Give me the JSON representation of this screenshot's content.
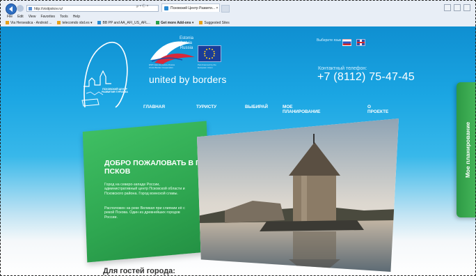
{
  "browser": {
    "url": "http://visitpskov.ru/",
    "url_tools": "℘ • Ⓒ ×",
    "tab_title": "Псковский Центр Развити... ×",
    "menu": [
      "File",
      "Edit",
      "View",
      "Favorites",
      "Tools",
      "Help"
    ],
    "favorites": [
      "Via Herseatica - Android ...",
      "telecomdo xbd.es ▾",
      "BB PP and AA_AFI_US_AFL...",
      "Get more Add-ons ▾",
      "Suggested Sites"
    ]
  },
  "header": {
    "countries": [
      "Estonia",
      "Latvia",
      "Russia"
    ],
    "slogan": "united by borders",
    "program_note": "ENPI Estonia-Latvia-Russia Cross Border Cooperation",
    "eu_note": "Part-financed by the European Union",
    "lang_label": "Выберите язык",
    "phone_label": "Контактный телефон:",
    "phone": "+7 (8112) 75-47-45",
    "logo_caption": "ПСКОВСКИЙ ЦЕНТР РАЗВИТИЯ ТУРИЗМА"
  },
  "menu": [
    "ГЛАВНАЯ",
    "ТУРИСТУ",
    "ВЫБИРАЙ",
    "МОЕ ПЛАНИРОВАНИЕ",
    "О ПРОЕКТЕ"
  ],
  "side_tab": "Мое планирование",
  "hero": {
    "title": "ДОБРО ПОЖАЛОВАТЬ В Г. ПСКОВ",
    "p1": "Город на северо-западе России, административный центр Псковской области и Псковского района. Город воинской славы.",
    "p2": "Расположен на реке Великая при слиянии её с рекой Пскова. Один из древнейших городов России."
  },
  "guest_heading": "Для гостей города:",
  "colors": {
    "accent_blue": "#1ba6e3",
    "green": "#2ea650"
  }
}
